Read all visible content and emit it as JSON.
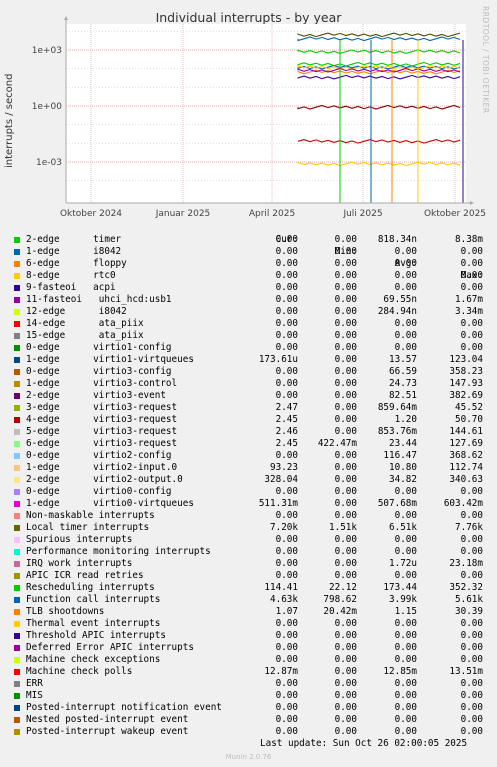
{
  "chart_data": {
    "type": "line",
    "title": "Individual interrupts - by year",
    "ylabel": "interrupts / second",
    "yscale": "log",
    "y_ticks": [
      "1e+03",
      "1e+00",
      "1e-03"
    ],
    "x_ticks": [
      "Oktober 2024",
      "Januar 2025",
      "April 2025",
      "Juli 2025",
      "Oktober 2025"
    ],
    "grid": true,
    "series": [
      {
        "name": "timer",
        "color": "#00cc00",
        "level": 818.34
      },
      {
        "name": "virtio1-virtqueues",
        "color": "#0066b3",
        "level": 120
      },
      {
        "name": "virtio3-config",
        "color": "#ff8000",
        "level": 66
      },
      {
        "name": "virtio2-config",
        "color": "#ffcc00",
        "level": 116
      },
      {
        "name": "virtio2-output.0",
        "color": "#330099",
        "level": 35
      },
      {
        "name": "Local timer interrupts",
        "color": "#4d4d00",
        "level": 6510
      },
      {
        "name": "Function call interrupts",
        "color": "#0066b3",
        "level": 3990
      },
      {
        "name": "Rescheduling interrupts",
        "color": "#00cc00",
        "level": 173
      },
      {
        "name": "virtio3-event",
        "color": "#990099",
        "level": 82
      },
      {
        "name": "virtio3-request",
        "color": "#800000",
        "level": 0.86
      },
      {
        "name": "Machine check polls",
        "color": "#cc0000",
        "level": 0.0128
      },
      {
        "name": "virtio2-input.0",
        "color": "#ffcc00",
        "level": 0.0008
      }
    ]
  },
  "legend": {
    "headers": {
      "cur": "Cur:",
      "min": "Min:",
      "avg": "Avg:",
      "max": "Max:"
    },
    "rows": [
      {
        "name": "2-edge      timer",
        "color": "#00cc00",
        "cur": "0.00",
        "min": "0.00",
        "avg": "818.34n",
        "max": "8.38m"
      },
      {
        "name": "1-edge      i8042",
        "color": "#0066b3",
        "cur": "0.00",
        "min": "0.00",
        "avg": "0.00",
        "max": "0.00"
      },
      {
        "name": "6-edge      floppy",
        "color": "#ff8000",
        "cur": "0.00",
        "min": "0.00",
        "avg": "0.00",
        "max": "0.00"
      },
      {
        "name": "8-edge      rtc0",
        "color": "#ffcc00",
        "cur": "0.00",
        "min": "0.00",
        "avg": "0.00",
        "max": "0.00"
      },
      {
        "name": "9-fasteoi   acpi",
        "color": "#330099",
        "cur": "0.00",
        "min": "0.00",
        "avg": "0.00",
        "max": "0.00"
      },
      {
        "name": "11-fasteoi   uhci_hcd:usb1",
        "color": "#990099",
        "cur": "0.00",
        "min": "0.00",
        "avg": "69.55n",
        "max": "1.67m"
      },
      {
        "name": "12-edge      i8042",
        "color": "#ccff00",
        "cur": "0.00",
        "min": "0.00",
        "avg": "284.94n",
        "max": "3.34m"
      },
      {
        "name": "14-edge      ata_piix",
        "color": "#ff0000",
        "cur": "0.00",
        "min": "0.00",
        "avg": "0.00",
        "max": "0.00"
      },
      {
        "name": "15-edge      ata_piix",
        "color": "#808080",
        "cur": "0.00",
        "min": "0.00",
        "avg": "0.00",
        "max": "0.00"
      },
      {
        "name": "0-edge      virtio1-config",
        "color": "#008f00",
        "cur": "0.00",
        "min": "0.00",
        "avg": "0.00",
        "max": "0.00"
      },
      {
        "name": "1-edge      virtio1-virtqueues",
        "color": "#00487d",
        "cur": "173.61u",
        "min": "0.00",
        "avg": "13.57",
        "max": "123.04"
      },
      {
        "name": "0-edge      virtio3-config",
        "color": "#b35a00",
        "cur": "0.00",
        "min": "0.00",
        "avg": "66.59",
        "max": "358.23"
      },
      {
        "name": "1-edge      virtio3-control",
        "color": "#b38f00",
        "cur": "0.00",
        "min": "0.00",
        "avg": "24.73",
        "max": "147.93"
      },
      {
        "name": "2-edge      virtio3-event",
        "color": "#6b006b",
        "cur": "0.00",
        "min": "0.00",
        "avg": "82.51",
        "max": "382.69"
      },
      {
        "name": "3-edge      virtio3-request",
        "color": "#8fb300",
        "cur": "2.47",
        "min": "0.00",
        "avg": "859.64m",
        "max": "45.52"
      },
      {
        "name": "4-edge      virtio3-request",
        "color": "#b30000",
        "cur": "2.45",
        "min": "0.00",
        "avg": "1.20",
        "max": "50.70"
      },
      {
        "name": "5-edge      virtio3-request",
        "color": "#bebebe",
        "cur": "2.46",
        "min": "0.00",
        "avg": "853.76m",
        "max": "144.61"
      },
      {
        "name": "6-edge      virtio3-request",
        "color": "#80ff80",
        "cur": "2.45",
        "min": "422.47m",
        "avg": "23.44",
        "max": "127.69"
      },
      {
        "name": "0-edge      virtio2-config",
        "color": "#80c9ff",
        "cur": "0.00",
        "min": "0.00",
        "avg": "116.47",
        "max": "368.62"
      },
      {
        "name": "1-edge      virtio2-input.0",
        "color": "#ffc080",
        "cur": "93.23",
        "min": "0.00",
        "avg": "10.80",
        "max": "112.74"
      },
      {
        "name": "2-edge      virtio2-output.0",
        "color": "#ffe680",
        "cur": "328.04",
        "min": "0.00",
        "avg": "34.82",
        "max": "340.63"
      },
      {
        "name": "0-edge      virtio0-config",
        "color": "#aa80ff",
        "cur": "0.00",
        "min": "0.00",
        "avg": "0.00",
        "max": "0.00"
      },
      {
        "name": "1-edge      virtio0-virtqueues",
        "color": "#ee00cc",
        "cur": "511.31m",
        "min": "0.00",
        "avg": "507.68m",
        "max": "603.42m"
      },
      {
        "name": "Non-maskable interrupts",
        "color": "#ff8080",
        "cur": "0.00",
        "min": "0.00",
        "avg": "0.00",
        "max": "0.00"
      },
      {
        "name": "Local timer interrupts",
        "color": "#666600",
        "cur": "7.20k",
        "min": "1.51k",
        "avg": "6.51k",
        "max": "7.76k"
      },
      {
        "name": "Spurious interrupts",
        "color": "#ffbfff",
        "cur": "0.00",
        "min": "0.00",
        "avg": "0.00",
        "max": "0.00"
      },
      {
        "name": "Performance monitoring interrupts",
        "color": "#00ffcc",
        "cur": "0.00",
        "min": "0.00",
        "avg": "0.00",
        "max": "0.00"
      },
      {
        "name": "IRQ work interrupts",
        "color": "#cc6699",
        "cur": "0.00",
        "min": "0.00",
        "avg": "1.72u",
        "max": "23.18m"
      },
      {
        "name": "APIC ICR read retries",
        "color": "#999900",
        "cur": "0.00",
        "min": "0.00",
        "avg": "0.00",
        "max": "0.00"
      },
      {
        "name": "Rescheduling interrupts",
        "color": "#00cc00",
        "cur": "114.41",
        "min": "22.12",
        "avg": "173.44",
        "max": "352.32"
      },
      {
        "name": "Function call interrupts",
        "color": "#0066b3",
        "cur": "4.63k",
        "min": "798.62",
        "avg": "3.99k",
        "max": "5.61k"
      },
      {
        "name": "TLB shootdowns",
        "color": "#ff8000",
        "cur": "1.07",
        "min": "20.42m",
        "avg": "1.15",
        "max": "30.39"
      },
      {
        "name": "Thermal event interrupts",
        "color": "#ffcc00",
        "cur": "0.00",
        "min": "0.00",
        "avg": "0.00",
        "max": "0.00"
      },
      {
        "name": "Threshold APIC interrupts",
        "color": "#330099",
        "cur": "0.00",
        "min": "0.00",
        "avg": "0.00",
        "max": "0.00"
      },
      {
        "name": "Deferred Error APIC interrupts",
        "color": "#990099",
        "cur": "0.00",
        "min": "0.00",
        "avg": "0.00",
        "max": "0.00"
      },
      {
        "name": "Machine check exceptions",
        "color": "#ccff00",
        "cur": "0.00",
        "min": "0.00",
        "avg": "0.00",
        "max": "0.00"
      },
      {
        "name": "Machine check polls",
        "color": "#ff0000",
        "cur": "12.87m",
        "min": "0.00",
        "avg": "12.85m",
        "max": "13.51m"
      },
      {
        "name": "ERR",
        "color": "#808080",
        "cur": "0.00",
        "min": "0.00",
        "avg": "0.00",
        "max": "0.00"
      },
      {
        "name": "MIS",
        "color": "#008f00",
        "cur": "0.00",
        "min": "0.00",
        "avg": "0.00",
        "max": "0.00"
      },
      {
        "name": "Posted-interrupt notification event",
        "color": "#00487d",
        "cur": "0.00",
        "min": "0.00",
        "avg": "0.00",
        "max": "0.00"
      },
      {
        "name": "Nested posted-interrupt event",
        "color": "#b35a00",
        "cur": "0.00",
        "min": "0.00",
        "avg": "0.00",
        "max": "0.00"
      },
      {
        "name": "Posted-interrupt wakeup event",
        "color": "#b38f00",
        "cur": "0.00",
        "min": "0.00",
        "avg": "0.00",
        "max": "0.00"
      }
    ]
  },
  "footer": {
    "last_update": "Last update: Sun Oct 26 02:00:05 2025",
    "munin": "Munin 2.0.76",
    "rrdtool": "RRDTOOL / TOBI OETIKER"
  }
}
